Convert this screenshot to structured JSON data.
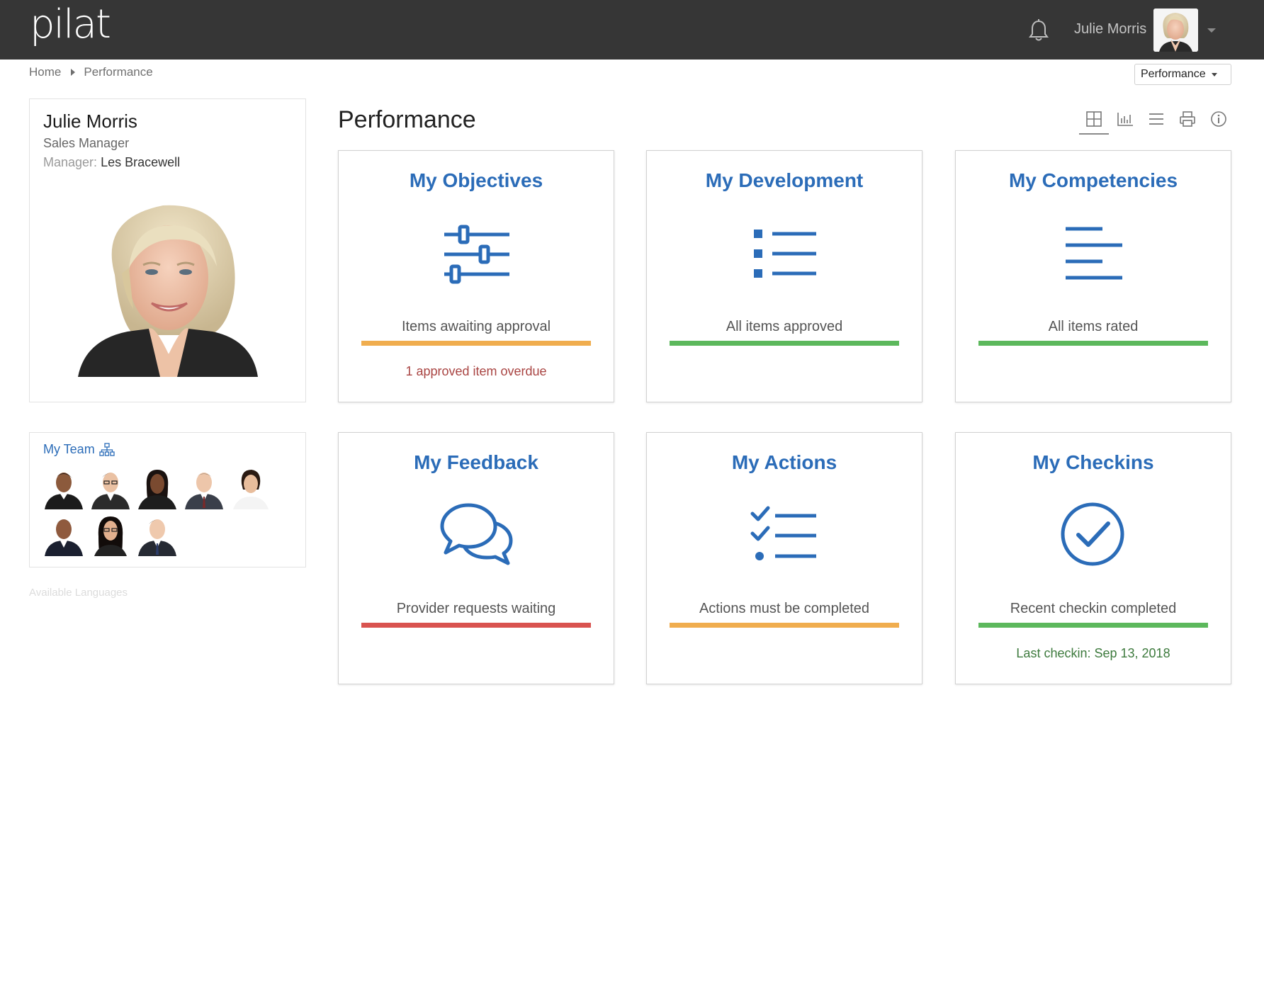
{
  "app": {
    "logo_text": "pilat"
  },
  "header": {
    "user_name": "Julie Morris",
    "icons": {
      "notifications": "bell-icon",
      "menu": "caret-down-icon"
    }
  },
  "breadcrumb": {
    "items": [
      "Home",
      "Performance"
    ]
  },
  "module_select": {
    "value": "Performance"
  },
  "profile": {
    "name": "Julie Morris",
    "role": "Sales Manager",
    "manager_label": "Manager:",
    "manager_name": "Les Bracewell"
  },
  "team": {
    "title": "My Team",
    "icon": "org-chart-icon",
    "member_count": 8
  },
  "footer": {
    "languages_label": "Available Languages"
  },
  "page": {
    "title": "Performance"
  },
  "view_tools": [
    "grid-view-icon",
    "chart-view-icon",
    "list-view-icon",
    "print-icon",
    "info-icon"
  ],
  "colors": {
    "accent": "#2b6cb8",
    "warning": "#f0ad4e",
    "success": "#5cb85c",
    "danger": "#d9534f",
    "header_bg": "#363636"
  },
  "tiles": [
    {
      "title": "My Objectives",
      "icon": "sliders-icon",
      "status": "Items awaiting approval",
      "bar_color": "#f0ad4e",
      "sub": "1 approved item overdue",
      "sub_color": "#a94442"
    },
    {
      "title": "My Development",
      "icon": "bulleted-list-icon",
      "status": "All items approved",
      "bar_color": "#5cb85c",
      "sub": "",
      "sub_color": ""
    },
    {
      "title": "My Competencies",
      "icon": "text-lines-icon",
      "status": "All items rated",
      "bar_color": "#5cb85c",
      "sub": "",
      "sub_color": ""
    },
    {
      "title": "My Feedback",
      "icon": "chat-bubbles-icon",
      "status": "Provider requests waiting",
      "bar_color": "#d9534f",
      "sub": "",
      "sub_color": ""
    },
    {
      "title": "My Actions",
      "icon": "checklist-icon",
      "status": "Actions must be completed",
      "bar_color": "#f0ad4e",
      "sub": "",
      "sub_color": ""
    },
    {
      "title": "My Checkins",
      "icon": "check-circle-icon",
      "status": "Recent checkin completed",
      "bar_color": "#5cb85c",
      "sub": "Last checkin: Sep 13, 2018",
      "sub_color": "#3d7a3d"
    }
  ]
}
